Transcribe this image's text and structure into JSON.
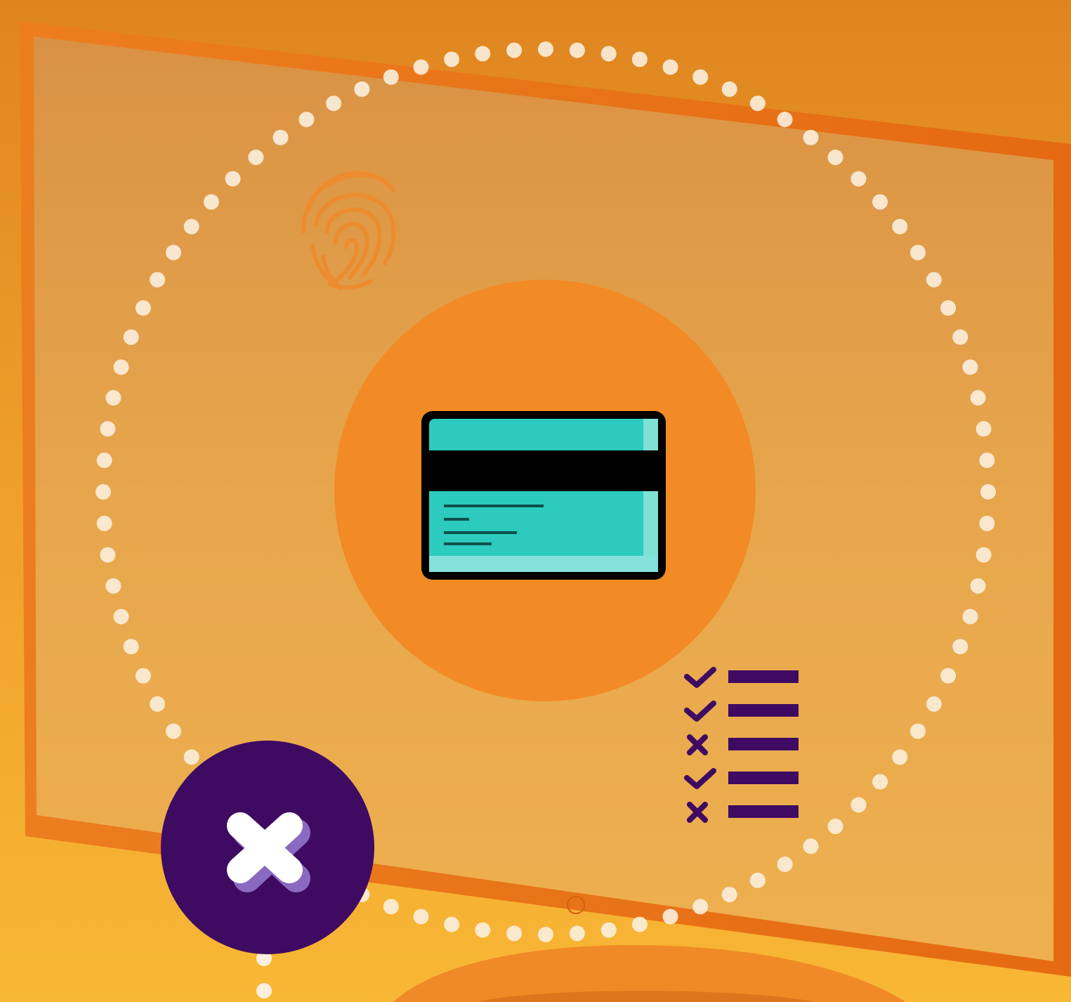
{
  "scene": {
    "description_icons": {
      "fingerprint": "fingerprint-icon",
      "card": "credit-card-icon",
      "checklist": "checklist-icon",
      "close": "close-icon"
    },
    "colors": {
      "background_top": "#e08a22",
      "background_bottom": "#f7b433",
      "monitor_frame": "#ef7a1a",
      "monitor_screen": "#e7a446",
      "accent_circle": "#f28a25",
      "card_teal": "#2ccbbe",
      "card_stripe": "#000000",
      "checklist_purple": "#3e0a62",
      "close_badge": "#3e0a62",
      "dots": "#fbeedd"
    },
    "checklist": {
      "items": [
        {
          "status": "check"
        },
        {
          "status": "check"
        },
        {
          "status": "cross"
        },
        {
          "status": "check"
        },
        {
          "status": "cross"
        }
      ]
    }
  }
}
